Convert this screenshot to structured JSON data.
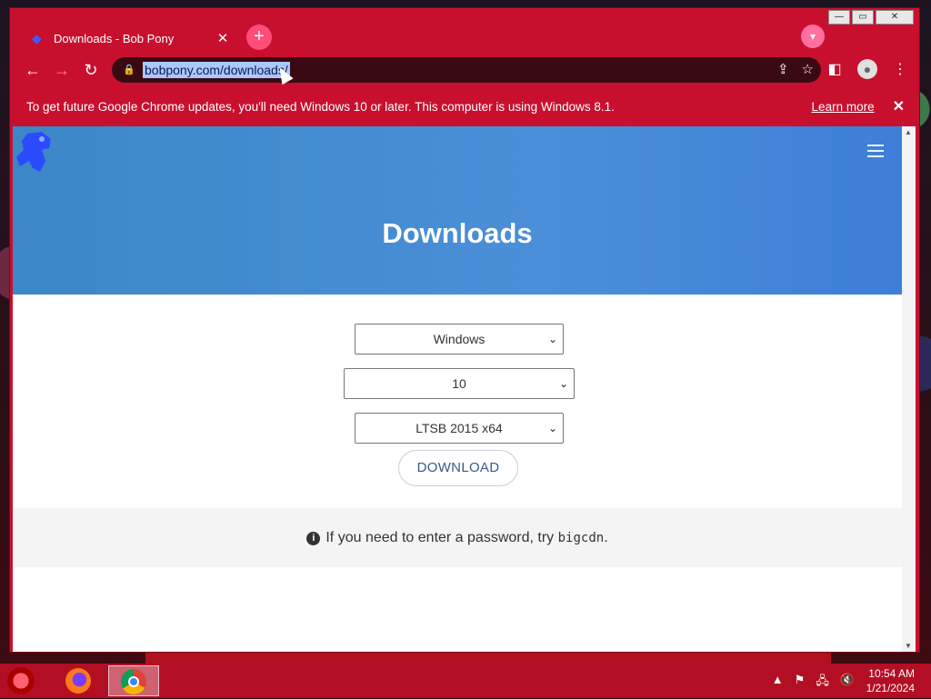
{
  "browser": {
    "tab": {
      "title": "Downloads - Bob Pony",
      "close": "✕"
    },
    "new_tab": "+",
    "url": "bobpony.com/downloads/"
  },
  "infobar": {
    "message": "To get future Google Chrome updates, you'll need Windows 10 or later. This computer is using Windows 8.1.",
    "link": "Learn more",
    "close": "✕"
  },
  "page": {
    "title": "Downloads",
    "os_select": {
      "value": "Windows"
    },
    "version_select": {
      "value": "10"
    },
    "edition_select": {
      "value": "LTSB 2015 x64"
    },
    "download_label": "DOWNLOAD",
    "notice_prefix": "If you need to enter a password, try ",
    "notice_code": "bigcdn",
    "notice_suffix": "."
  },
  "taskbar": {
    "time": "10:54 AM",
    "date": "1/21/2024"
  }
}
